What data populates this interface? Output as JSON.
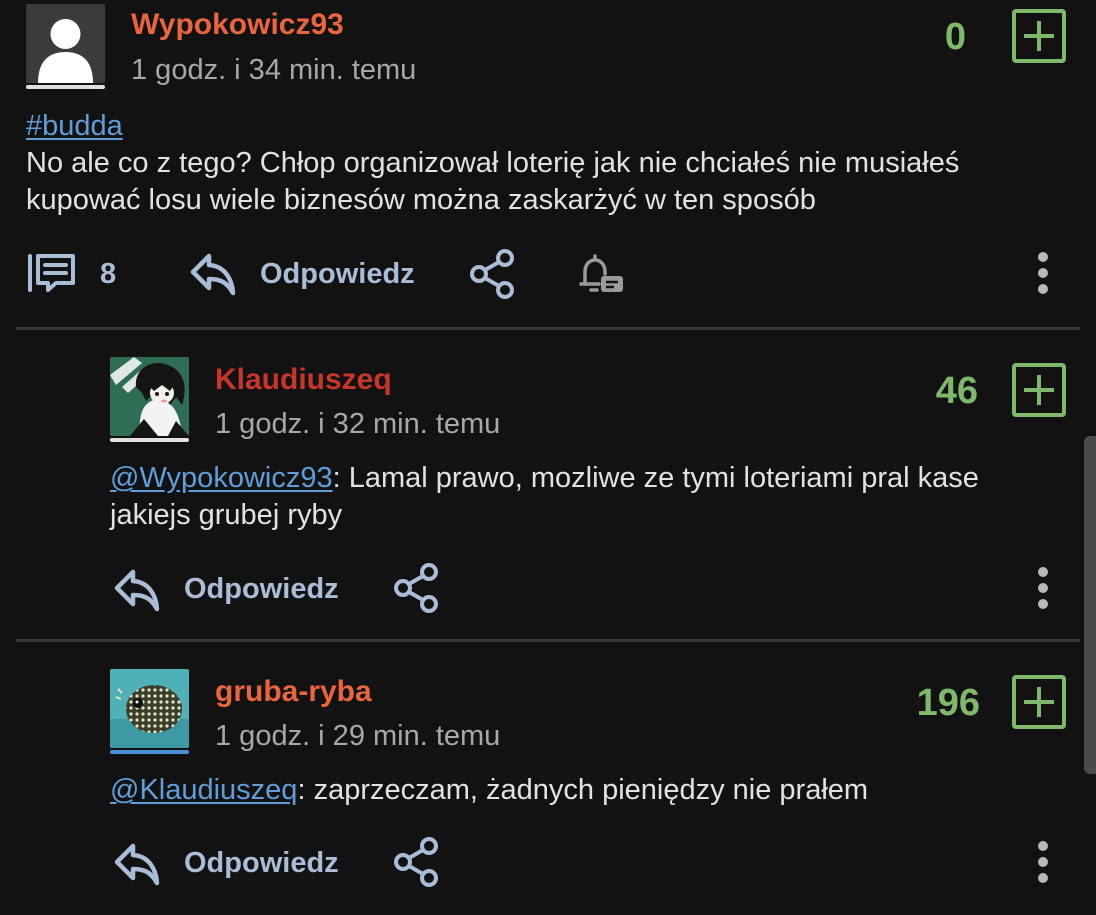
{
  "posts": [
    {
      "author": "Wypokowicz93",
      "author_color": "#e8653d",
      "time": "1 godz. i 34 min. temu",
      "votes": "0",
      "tag": "#budda",
      "text": "No ale co z tego? Chłop organizował loterię jak nie chciałeś nie musiałeś kupować losu wiele biznesów można zaskarżyć w ten sposób",
      "comment_count": "8",
      "reply_label": "Odpowiedz"
    },
    {
      "author": "Klaudiuszeq",
      "author_color": "#c7352b",
      "time": "1 godz. i 32 min. temu",
      "votes": "46",
      "mention": "@Wypokowicz93",
      "text": ": Lamal prawo, mozliwe ze tymi loteriami pral kase jakiejs grubej ryby",
      "reply_label": "Odpowiedz"
    },
    {
      "author": "gruba-ryba",
      "author_color": "#e8653d",
      "time": "1 godz. i 29 min. temu",
      "votes": "196",
      "mention": "@Klaudiuszeq",
      "text": ": zaprzeczam, żadnych pieniędzy nie prałem",
      "reply_label": "Odpowiedz"
    }
  ]
}
